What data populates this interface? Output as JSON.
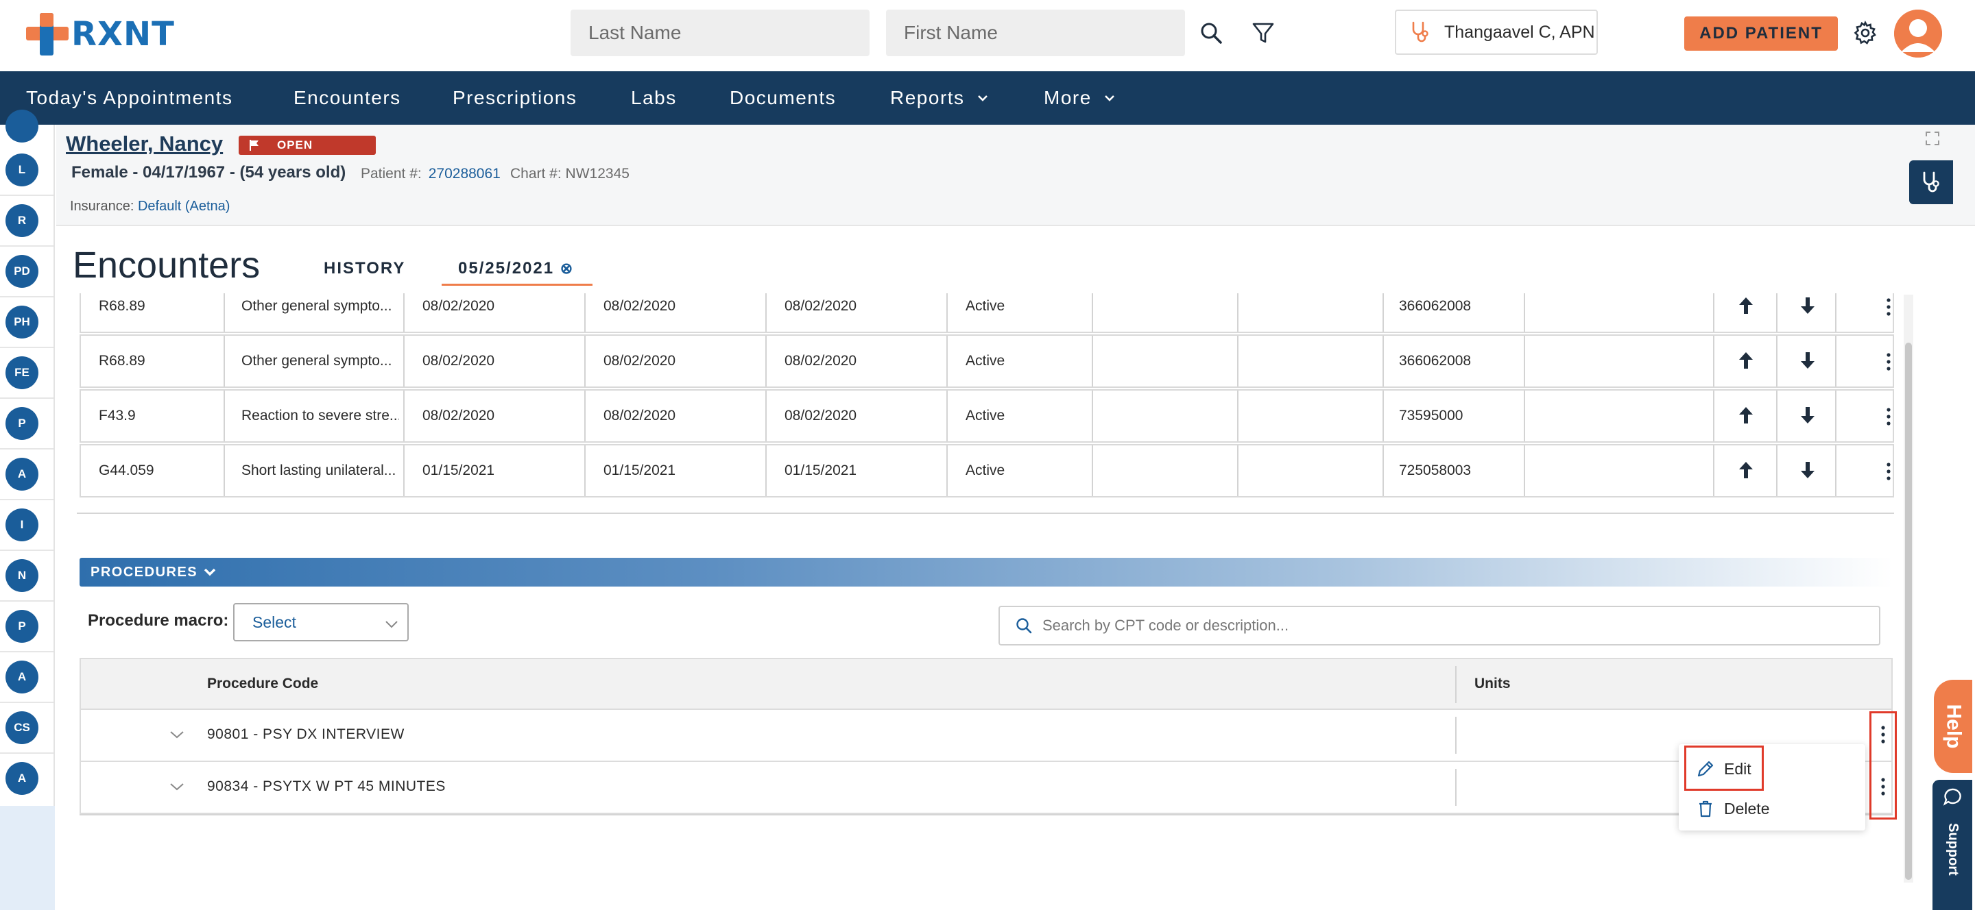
{
  "brand": {
    "name": "RXNT",
    "colors": {
      "primary": "#1b6fb5",
      "accent": "#ef7d4a",
      "nav": "#173b5e"
    }
  },
  "header": {
    "last_name_placeholder": "Last Name",
    "first_name_placeholder": "First Name",
    "provider": "Thangaavel C, APN",
    "add_patient": "ADD PATIENT"
  },
  "nav": {
    "items": [
      {
        "label": "Today's Appointments"
      },
      {
        "label": "Encounters"
      },
      {
        "label": "Prescriptions"
      },
      {
        "label": "Labs"
      },
      {
        "label": "Documents"
      },
      {
        "label": "Reports"
      },
      {
        "label": "More"
      }
    ]
  },
  "sidebar": {
    "items": [
      "L",
      "R",
      "PD",
      "PH",
      "FE",
      "P",
      "A",
      "I",
      "N",
      "P",
      "A",
      "CS",
      "A"
    ]
  },
  "patient": {
    "name": "Wheeler, Nancy",
    "status": "OPEN",
    "demographics": "Female - 04/17/1967 - (54 years old)",
    "patient_no_label": "Patient #:",
    "patient_no": "270288061",
    "chart_no_label": "Chart #:",
    "chart_no": "NW12345",
    "insurance_label": "Insurance:",
    "insurance": "Default (Aetna)"
  },
  "encounters": {
    "title": "Encounters",
    "tabs": [
      {
        "label": "HISTORY"
      },
      {
        "label": "05/25/2021"
      }
    ]
  },
  "diagnoses": {
    "rows": [
      {
        "code": "R68.89",
        "desc": "Other general sympto...",
        "d1": "08/02/2020",
        "d2": "08/02/2020",
        "d3": "08/02/2020",
        "status": "Active",
        "snomed": "366062008"
      },
      {
        "code": "R68.89",
        "desc": "Other general sympto...",
        "d1": "08/02/2020",
        "d2": "08/02/2020",
        "d3": "08/02/2020",
        "status": "Active",
        "snomed": "366062008"
      },
      {
        "code": "F43.9",
        "desc": "Reaction to severe stre...",
        "d1": "08/02/2020",
        "d2": "08/02/2020",
        "d3": "08/02/2020",
        "status": "Active",
        "snomed": "73595000"
      },
      {
        "code": "G44.059",
        "desc": "Short lasting unilateral...",
        "d1": "01/15/2021",
        "d2": "01/15/2021",
        "d3": "01/15/2021",
        "status": "Active",
        "snomed": "725058003"
      }
    ]
  },
  "procedures": {
    "section_title": "PROCEDURES",
    "macro_label": "Procedure macro:",
    "macro_value": "Select",
    "search_placeholder": "Search by CPT code or description...",
    "col_code": "Procedure Code",
    "col_units": "Units",
    "rows": [
      {
        "code": "90801 - PSY DX INTERVIEW"
      },
      {
        "code": "90834 - PSYTX W PT 45 MINUTES"
      }
    ],
    "menu": {
      "edit": "Edit",
      "delete": "Delete"
    }
  },
  "widgets": {
    "help": "Help",
    "support": "Support"
  }
}
